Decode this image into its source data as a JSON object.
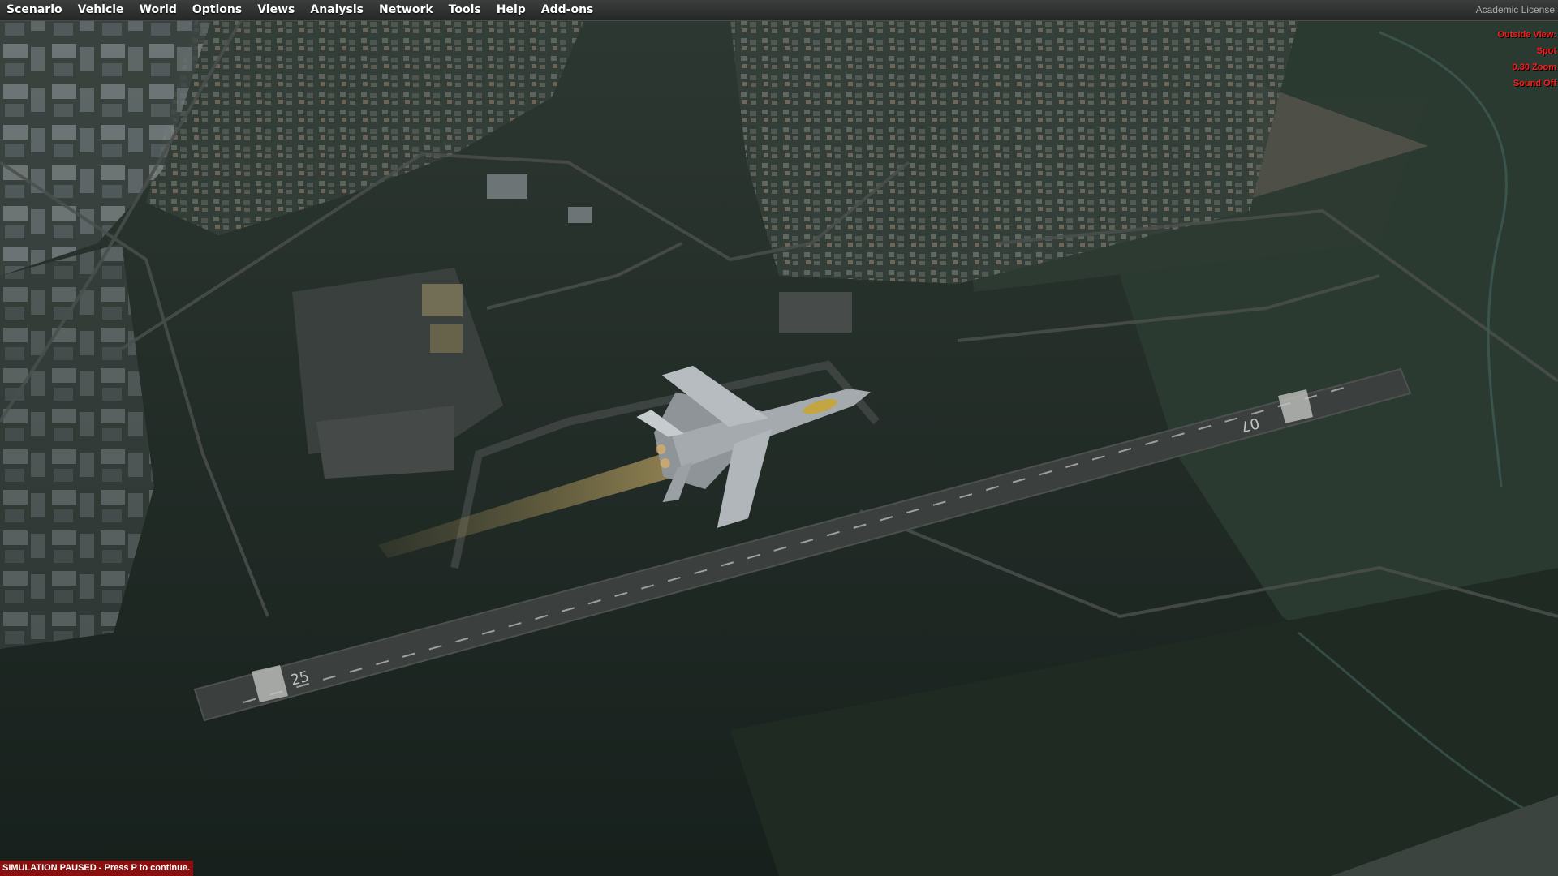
{
  "menubar": {
    "items": [
      {
        "label": "Scenario",
        "key": "scenario"
      },
      {
        "label": "Vehicle",
        "key": "vehicle"
      },
      {
        "label": "World",
        "key": "world"
      },
      {
        "label": "Options",
        "key": "options"
      },
      {
        "label": "Views",
        "key": "views"
      },
      {
        "label": "Analysis",
        "key": "analysis"
      },
      {
        "label": "Network",
        "key": "network"
      },
      {
        "label": "Tools",
        "key": "tools"
      },
      {
        "label": "Help",
        "key": "help"
      },
      {
        "label": "Add-ons",
        "key": "add-ons"
      }
    ],
    "license": "Academic License"
  },
  "view_info": {
    "line1": "Outside View:",
    "line2": "Spot",
    "line3": "0.30 Zoom",
    "line4": "Sound Off"
  },
  "runway": {
    "number_west": "25",
    "number_east": "07"
  },
  "status": {
    "paused": "SIMULATION PAUSED - Press P to continue."
  },
  "colors": {
    "hud_text": "#ff1a1a",
    "paused_bg": "#8a1010",
    "menubar_bg": "#2f3131"
  }
}
